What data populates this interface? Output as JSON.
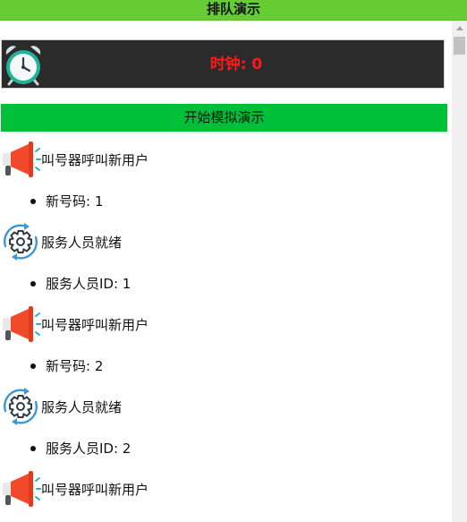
{
  "header": {
    "title": "排队演示"
  },
  "clock": {
    "label": "时钟: 0",
    "icon": "alarm-clock-icon"
  },
  "controls": {
    "start_label": "开始模拟演示"
  },
  "log": [
    {
      "icon": "megaphone-icon",
      "text": "叫号器呼叫新用户",
      "detail": "新号码: 1"
    },
    {
      "icon": "gear-icon",
      "text": "服务人员就绪",
      "detail": "服务人员ID: 1"
    },
    {
      "icon": "megaphone-icon",
      "text": "叫号器呼叫新用户",
      "detail": "新号码: 2"
    },
    {
      "icon": "gear-icon",
      "text": "服务人员就绪",
      "detail": "服务人员ID: 2"
    },
    {
      "icon": "megaphone-icon",
      "text": "叫号器呼叫新用户"
    }
  ],
  "colors": {
    "header_bg": "#66cc33",
    "clock_bg": "#2b2b2b",
    "clock_text": "#ff1a1a",
    "button_bg": "#00c03a"
  }
}
